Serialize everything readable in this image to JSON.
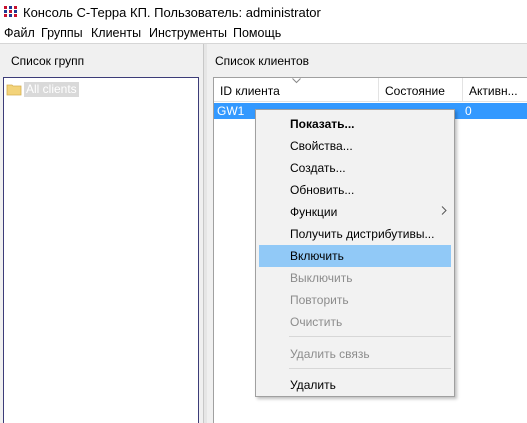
{
  "window": {
    "title": "Консоль С-Терра КП. Пользователь: administrator"
  },
  "menubar": [
    "Файл",
    "Группы",
    "Клиенты",
    "Инструменты",
    "Помощь"
  ],
  "groups_pane": {
    "header": "Список групп",
    "tree": [
      {
        "label": "All clients",
        "icon": "folder-icon",
        "selected": true
      }
    ]
  },
  "clients_pane": {
    "header": "Список клиентов",
    "columns": [
      "ID клиента",
      "Состояние",
      "Активн..."
    ],
    "rows": [
      {
        "id": "GW1",
        "state": "",
        "active": "0",
        "selected": true
      }
    ]
  },
  "context_menu": {
    "items": [
      {
        "label": "Показать...",
        "bold": true,
        "enabled": true
      },
      {
        "label": "Свойства...",
        "enabled": true
      },
      {
        "label": "Создать...",
        "enabled": true
      },
      {
        "label": "Обновить...",
        "enabled": true
      },
      {
        "label": "Функции",
        "enabled": true,
        "submenu": true
      },
      {
        "label": "Получить дистрибутивы...",
        "enabled": true
      },
      {
        "label": "Включить",
        "enabled": true,
        "highlighted": true
      },
      {
        "label": "Выключить",
        "enabled": false
      },
      {
        "label": "Повторить",
        "enabled": false
      },
      {
        "label": "Очистить",
        "enabled": false
      },
      {
        "label": "Удалить связь",
        "enabled": false
      },
      {
        "label": "Удалить",
        "enabled": true
      }
    ]
  },
  "colors": {
    "selection": "#3399ff",
    "menu_highlight": "#91c9f7",
    "disabled_text": "#8c8c8c"
  }
}
